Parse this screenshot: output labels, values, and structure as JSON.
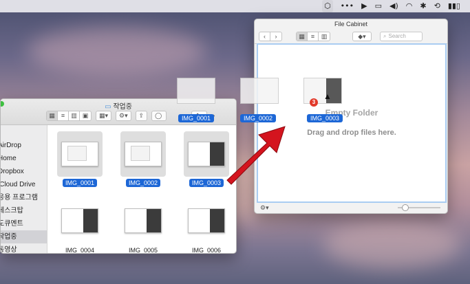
{
  "menubar": {
    "icons": [
      "drop-tray-icon",
      "more-icon",
      "video-icon",
      "airplay-icon",
      "volume-icon",
      "wifi-icon",
      "bluetooth-icon",
      "time-machine-icon",
      "battery-icon"
    ]
  },
  "file_cabinet": {
    "title": "File Cabinet",
    "search_placeholder": "Search",
    "empty_title": "Empty Folder",
    "empty_subtitle": "Drag and drop files here."
  },
  "finder": {
    "title": "작업중",
    "sidebar": [
      {
        "label": "AirDrop",
        "selected": false
      },
      {
        "label": "Home",
        "selected": false
      },
      {
        "label": "Dropbox",
        "selected": false
      },
      {
        "label": "iCloud Drive",
        "selected": false
      },
      {
        "label": "응용 프로그램",
        "selected": false
      },
      {
        "label": "데스크탑",
        "selected": false
      },
      {
        "label": "도큐멘트",
        "selected": false
      },
      {
        "label": "작업중",
        "selected": true
      },
      {
        "label": "동영상",
        "selected": false
      }
    ],
    "files": [
      {
        "name": "IMG_0001",
        "selected": true
      },
      {
        "name": "IMG_0002",
        "selected": true
      },
      {
        "name": "IMG_0003",
        "selected": true
      },
      {
        "name": "IMG_0004",
        "selected": false
      },
      {
        "name": "IMG_0005",
        "selected": false
      },
      {
        "name": "IMG_0006",
        "selected": false
      }
    ]
  },
  "drag": {
    "labels": [
      "IMG_0001",
      "IMG_0002",
      "IMG_0003"
    ],
    "count": "3"
  },
  "colors": {
    "selection": "#1d67d6",
    "arrow": "#d4141e",
    "badge": "#e23a2b"
  }
}
